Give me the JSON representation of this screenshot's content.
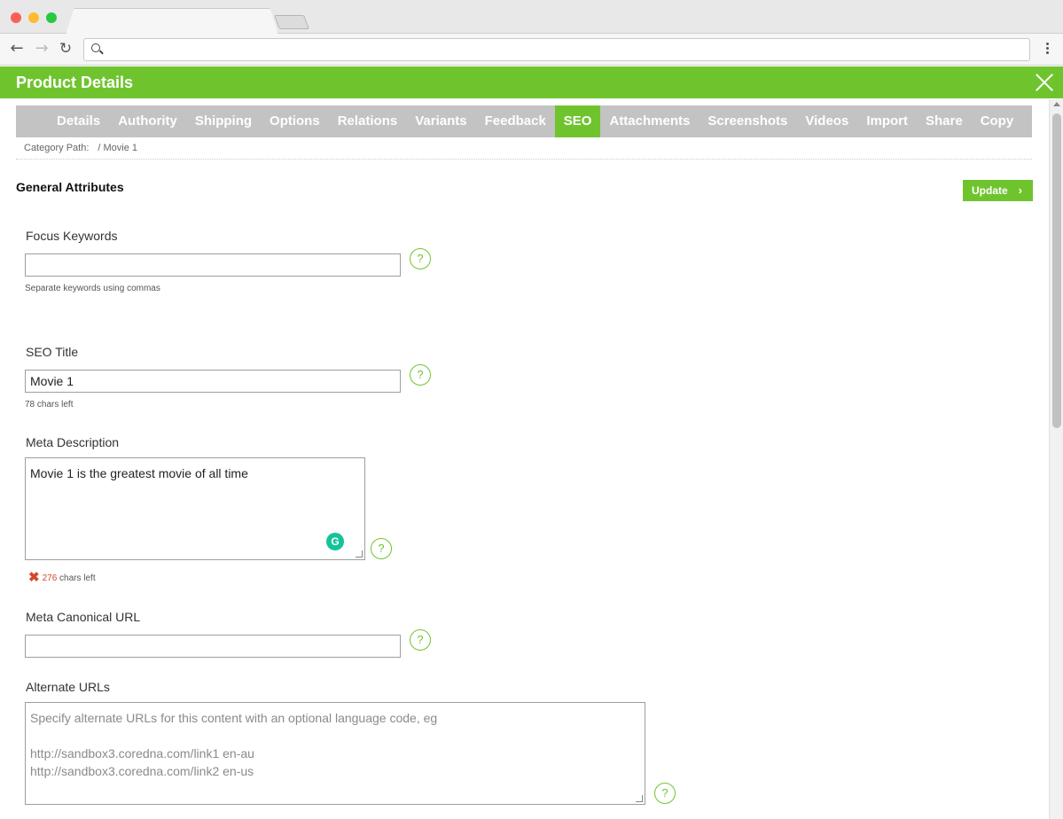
{
  "browser": {
    "address_value": ""
  },
  "app": {
    "title": "Product Details"
  },
  "tabs": [
    {
      "label": "Details"
    },
    {
      "label": "Authority"
    },
    {
      "label": "Shipping"
    },
    {
      "label": "Options"
    },
    {
      "label": "Relations"
    },
    {
      "label": "Variants"
    },
    {
      "label": "Feedback"
    },
    {
      "label": "SEO"
    },
    {
      "label": "Attachments"
    },
    {
      "label": "Screenshots"
    },
    {
      "label": "Videos"
    },
    {
      "label": "Import"
    },
    {
      "label": "Share"
    },
    {
      "label": "Copy"
    }
  ],
  "breadcrumb": {
    "label": "Category Path:",
    "value": "/ Movie 1"
  },
  "section": {
    "title": "General Attributes",
    "update_label": "Update",
    "update_chevron": "›"
  },
  "fields": {
    "focus_keywords": {
      "label": "Focus Keywords",
      "value": "",
      "hint": "Separate keywords using commas"
    },
    "seo_title": {
      "label": "SEO Title",
      "value": "Movie 1",
      "hint": "78 chars left"
    },
    "meta_description": {
      "label": "Meta Description",
      "value": "Movie 1 is the greatest movie of all time",
      "count": "276",
      "count_suffix": "chars left"
    },
    "canonical_url": {
      "label": "Meta Canonical URL",
      "value": ""
    },
    "alternate_urls": {
      "label": "Alternate URLs",
      "placeholder": "Specify alternate URLs for this content with an optional language code, eg\n\nhttp://sandbox3.coredna.com/link1 en-au\nhttp://sandbox3.coredna.com/link2 en-us"
    }
  },
  "help_glyph": "?",
  "grammarly_glyph": "G",
  "error_glyph": "✖",
  "colors": {
    "accent": "#6fc42e",
    "tab_bg": "#c3c3c3",
    "error": "#d24a2c",
    "grammarly": "#15c39a"
  }
}
